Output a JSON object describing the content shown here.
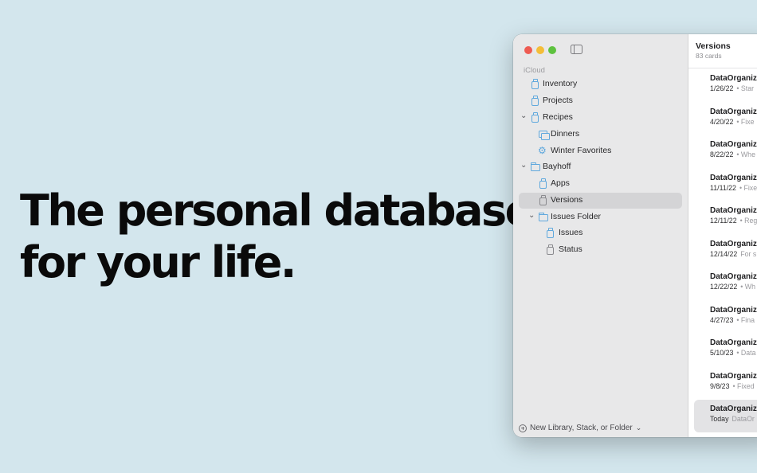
{
  "headline": {
    "line1": "The personal database",
    "line2": "for your life."
  },
  "sidebar": {
    "section_label": "iCloud",
    "items": [
      {
        "label": "Inventory"
      },
      {
        "label": "Projects"
      },
      {
        "label": "Recipes"
      },
      {
        "label": "Dinners"
      },
      {
        "label": "Winter Favorites"
      },
      {
        "label": "Bayhoff"
      },
      {
        "label": "Apps"
      },
      {
        "label": "Versions",
        "selected": true
      },
      {
        "label": "Issues Folder"
      },
      {
        "label": "Issues"
      },
      {
        "label": "Status"
      }
    ],
    "footer_label": "New Library, Stack, or Folder"
  },
  "content": {
    "title": "Versions",
    "subtitle": "83 cards",
    "cards": [
      {
        "title": "DataOrganize",
        "date": "1/26/22",
        "note": "• Star"
      },
      {
        "title": "DataOrganize",
        "date": "4/20/22",
        "note": "• Fixe"
      },
      {
        "title": "DataOrganize",
        "date": "8/22/22",
        "note": "• Whe"
      },
      {
        "title": "DataOrganize",
        "date": "11/11/22",
        "note": "• Fixe"
      },
      {
        "title": "DataOrganize",
        "date": "12/11/22",
        "note": "• Reg"
      },
      {
        "title": "DataOrganize",
        "date": "12/14/22",
        "note": "For s"
      },
      {
        "title": "DataOrganize",
        "date": "12/22/22",
        "note": "• Wh"
      },
      {
        "title": "DataOrganize",
        "date": "4/27/23",
        "note": "• Fina"
      },
      {
        "title": "DataOrganize",
        "date": "5/10/23",
        "note": "• Data"
      },
      {
        "title": "DataOrganize",
        "date": "9/8/23",
        "note": "• Fixed"
      },
      {
        "title": "DataOrganize",
        "date": "Today",
        "note": "DataOr",
        "selected": true
      }
    ]
  },
  "colors": {
    "background": "#d3e6ed",
    "accent": "#5fa8dd",
    "traffic_red": "#ee5b52",
    "traffic_yellow": "#f4bd38",
    "traffic_green": "#5ec23f"
  }
}
